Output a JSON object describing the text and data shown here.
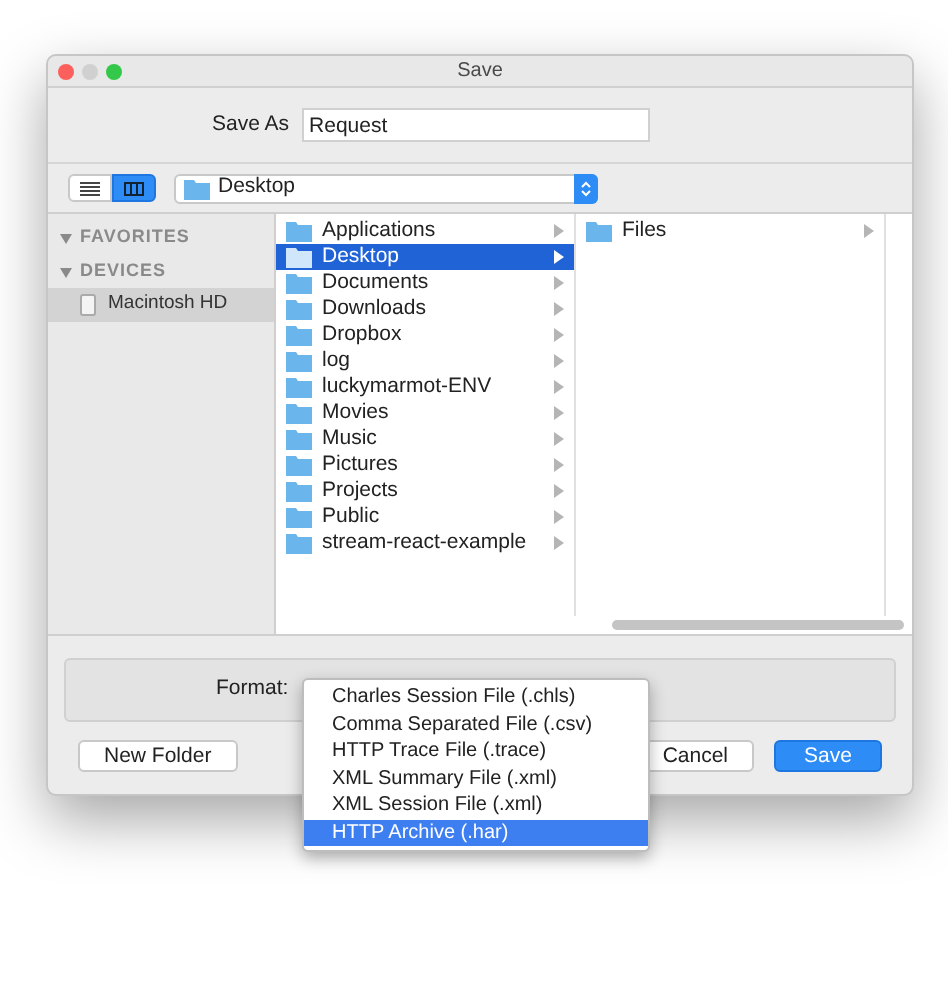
{
  "window": {
    "title": "Save"
  },
  "save_as": {
    "label": "Save As",
    "value": "Request"
  },
  "view_buttons": [
    {
      "kind": "list",
      "selected": false
    },
    {
      "kind": "columns",
      "selected": true
    }
  ],
  "location": {
    "value": "Desktop"
  },
  "sidebar": {
    "sections": [
      {
        "title": "FAVORITES"
      },
      {
        "title": "DEVICES",
        "items": [
          {
            "label": "Macintosh HD",
            "selected": true
          }
        ]
      }
    ]
  },
  "columns": [
    {
      "items": [
        {
          "label": "Applications",
          "selected": false
        },
        {
          "label": "Desktop",
          "selected": true
        },
        {
          "label": "Documents",
          "selected": false
        },
        {
          "label": "Downloads",
          "selected": false
        },
        {
          "label": "Dropbox",
          "selected": false
        },
        {
          "label": "log",
          "selected": false
        },
        {
          "label": "luckymarmot-ENV",
          "selected": false
        },
        {
          "label": "Movies",
          "selected": false
        },
        {
          "label": "Music",
          "selected": false
        },
        {
          "label": "Pictures",
          "selected": false
        },
        {
          "label": "Projects",
          "selected": false
        },
        {
          "label": "Public",
          "selected": false
        },
        {
          "label": "stream-react-example",
          "selected": false
        }
      ]
    },
    {
      "items": [
        {
          "label": "Files",
          "selected": false
        }
      ]
    }
  ],
  "format": {
    "label": "Format:",
    "options": [
      {
        "label": "Charles Session File (.chls)",
        "selected": false
      },
      {
        "label": "Comma Separated File (.csv)",
        "selected": false
      },
      {
        "label": "HTTP Trace File (.trace)",
        "selected": false
      },
      {
        "label": "XML Summary File (.xml)",
        "selected": false
      },
      {
        "label": "XML Session File (.xml)",
        "selected": false
      },
      {
        "label": "HTTP Archive (.har)",
        "selected": true
      }
    ]
  },
  "buttons": [
    {
      "label": "New Folder",
      "kind": "normal"
    },
    {
      "label": "Cancel",
      "kind": "normal"
    },
    {
      "label": "Save",
      "kind": "default"
    }
  ]
}
